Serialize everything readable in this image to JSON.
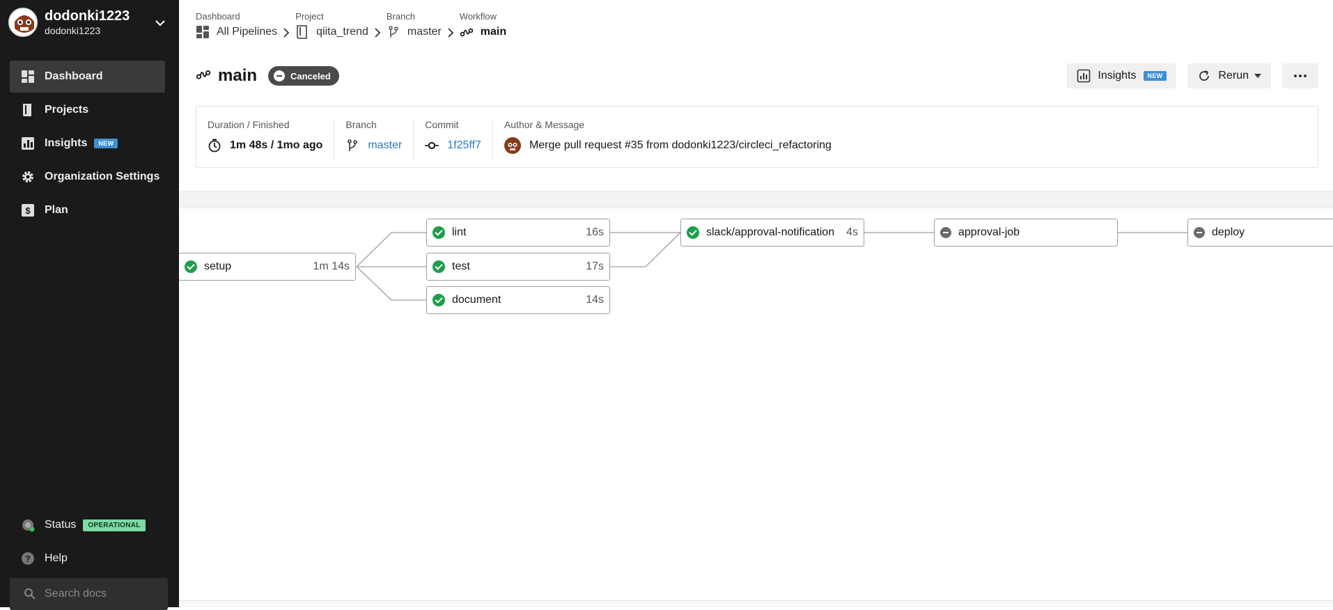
{
  "org": {
    "name": "dodonki1223",
    "sub": "dodonki1223"
  },
  "sidebar": {
    "items": [
      {
        "label": "Dashboard",
        "icon": "dashboard-icon",
        "active": true
      },
      {
        "label": "Projects",
        "icon": "projects-icon"
      },
      {
        "label": "Insights",
        "icon": "insights-icon",
        "badge": "NEW"
      },
      {
        "label": "Organization Settings",
        "icon": "gear-icon"
      },
      {
        "label": "Plan",
        "icon": "dollar-icon"
      }
    ],
    "status_label": "Status",
    "status_badge": "OPERATIONAL",
    "help_label": "Help",
    "search_placeholder": "Search docs"
  },
  "breadcrumb": [
    {
      "label": "Dashboard",
      "value": "All Pipelines",
      "icon": "pipelines-icon"
    },
    {
      "label": "Project",
      "value": "qiita_trend",
      "icon": "project-icon"
    },
    {
      "label": "Branch",
      "value": "master",
      "icon": "branch-icon"
    },
    {
      "label": "Workflow",
      "value": "main",
      "icon": "workflow-icon"
    }
  ],
  "header": {
    "title": "main",
    "status": "Canceled",
    "insights_label": "Insights",
    "insights_badge": "NEW",
    "rerun_label": "Rerun"
  },
  "info": {
    "duration_label": "Duration / Finished",
    "duration_value": "1m 48s / 1mo ago",
    "branch_label": "Branch",
    "branch_value": "master",
    "commit_label": "Commit",
    "commit_value": "1f25ff7",
    "author_label": "Author & Message",
    "message": "Merge pull request #35 from dodonki1223/circleci_refactoring"
  },
  "jobs": {
    "setup": {
      "name": "setup",
      "duration": "1m 14s",
      "status": "success"
    },
    "lint": {
      "name": "lint",
      "duration": "16s",
      "status": "success"
    },
    "test": {
      "name": "test",
      "duration": "17s",
      "status": "success"
    },
    "document": {
      "name": "document",
      "duration": "14s",
      "status": "success"
    },
    "slack": {
      "name": "slack/approval-notification",
      "duration": "4s",
      "status": "success"
    },
    "approval": {
      "name": "approval-job",
      "duration": "",
      "status": "canceled"
    },
    "deploy": {
      "name": "deploy",
      "duration": "",
      "status": "canceled"
    }
  },
  "colors": {
    "sidebar_bg": "#1a1a1a",
    "success": "#1e9e4a",
    "link": "#2a7bc0",
    "badge_new": "#3d8fd6",
    "operational": "#7fd9a4"
  }
}
